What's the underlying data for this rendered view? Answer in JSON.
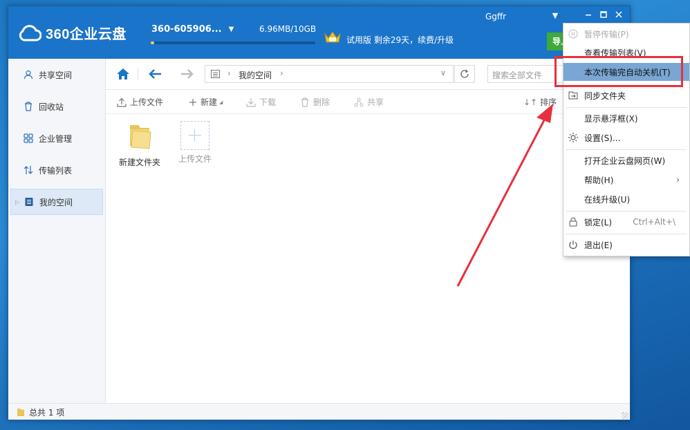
{
  "app": {
    "logo_text": "360企业云盘",
    "account_name": "360-605906...",
    "quota_text": "6.96MB/10GB",
    "quota_fraction": 0.02,
    "trial_text": "试用版 剩余29天，续费/升级",
    "username": "Ggffr",
    "import_label": "导入"
  },
  "sidebar": {
    "items": [
      {
        "label": "共享空间",
        "icon": "user-icon"
      },
      {
        "label": "回收站",
        "icon": "trash-icon"
      },
      {
        "label": "企业管理",
        "icon": "grid-icon"
      },
      {
        "label": "传输列表",
        "icon": "transfer-icon"
      },
      {
        "label": "我的空间",
        "icon": "document-icon",
        "active": true
      }
    ]
  },
  "navbar": {
    "crumb": "我的空间",
    "search_placeholder": "搜索全部文件"
  },
  "toolbar": {
    "upload": "上传文件",
    "new": "新建",
    "download": "下载",
    "delete": "删除",
    "share": "共享",
    "sort": "排序"
  },
  "files": [
    {
      "name": "新建文件夹",
      "type": "folder"
    },
    {
      "name": "上传文件",
      "type": "upload-placeholder"
    }
  ],
  "status": {
    "count_text": "总共 1 项"
  },
  "menu": {
    "items": [
      {
        "label": "暂停传输(P)",
        "disabled": true,
        "icon": "pause-icon"
      },
      {
        "label": "查看传输列表(V)"
      },
      {
        "label": "本次传输完自动关机(T)",
        "highlighted": true
      },
      {
        "label": "同步文件夹",
        "icon": "sync-folder-icon"
      },
      {
        "label": "显示悬浮框(X)"
      },
      {
        "label": "设置(S)...",
        "icon": "gear-icon"
      },
      {
        "label": "打开企业云盘网页(W)"
      },
      {
        "label": "帮助(H)",
        "submenu": true
      },
      {
        "label": "在线升级(U)"
      },
      {
        "label": "锁定(L)",
        "shortcut": "Ctrl+Alt+\\",
        "icon": "lock-icon"
      },
      {
        "label": "退出(E)",
        "icon": "power-icon"
      }
    ]
  },
  "colors": {
    "titlebar": "#1a74c9",
    "accent": "#1a74c9",
    "highlight_box": "#e8303c",
    "menu_highlight": "#7aa6d4",
    "import_button": "#3fa93b"
  }
}
